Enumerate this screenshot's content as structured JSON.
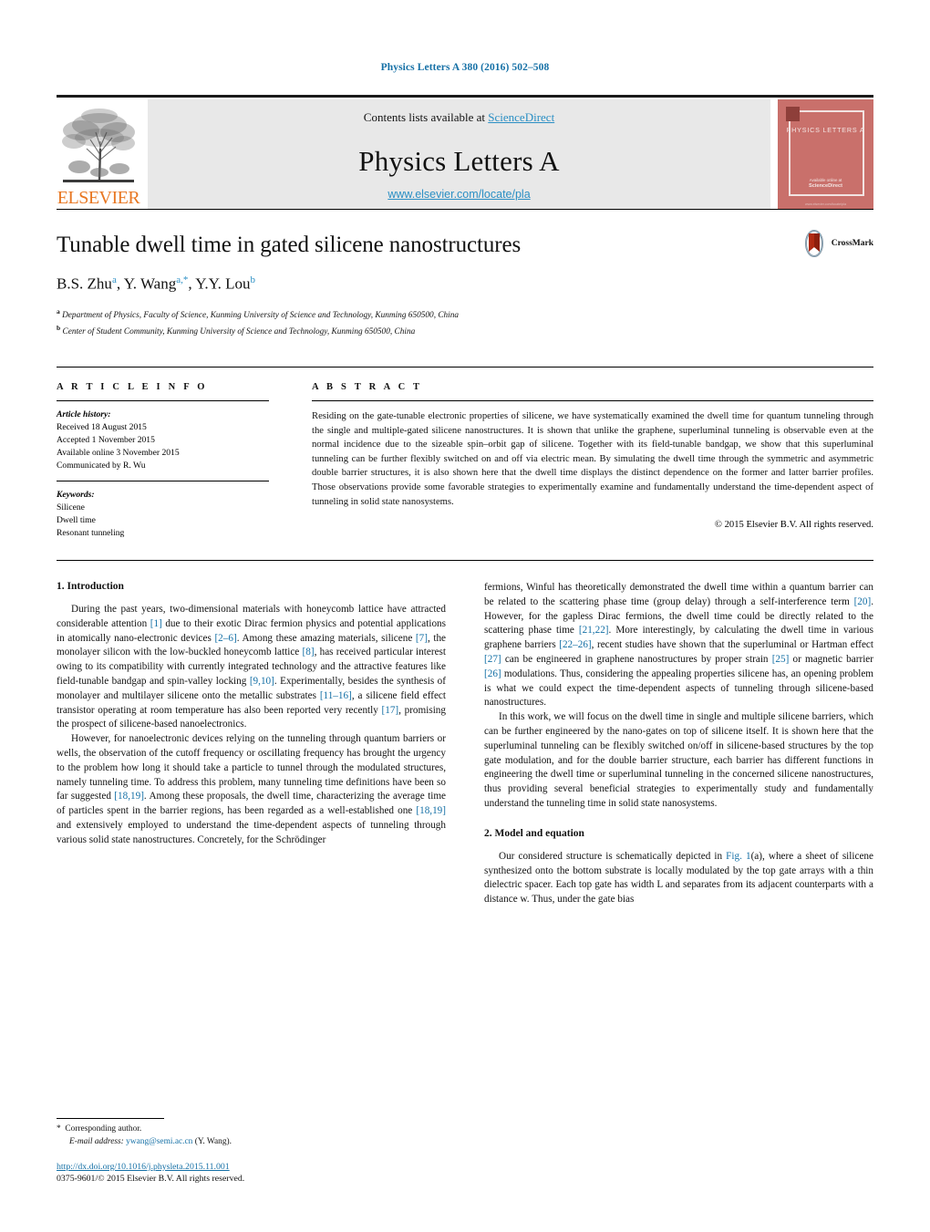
{
  "running_head": "Physics Letters A 380 (2016) 502–508",
  "banner": {
    "publisher_name": "ELSEVIER",
    "contents_prefix": "Contents lists available at ",
    "contents_link": "ScienceDirect",
    "journal_title": "Physics Letters A",
    "journal_url": "www.elsevier.com/locate/pla",
    "cover_title": "PHYSICS LETTERS A",
    "cover_foot_small": "Available online at",
    "cover_foot_brand": "ScienceDirect",
    "cover_bottom": "www.elsevier.com/locate/pla"
  },
  "title_block": {
    "title": "Tunable dwell time in gated silicene nanostructures",
    "authors": [
      {
        "name": "B.S. Zhu",
        "marks": "a"
      },
      {
        "name": "Y. Wang",
        "marks": "a,*"
      },
      {
        "name": "Y.Y. Lou",
        "marks": "b"
      }
    ],
    "affiliations": [
      {
        "mark": "a",
        "text": "Department of Physics, Faculty of Science, Kunming University of Science and Technology, Kunming 650500, China"
      },
      {
        "mark": "b",
        "text": "Center of Student Community, Kunming University of Science and Technology, Kunming 650500, China"
      }
    ],
    "crossmark_label": "CrossMark"
  },
  "article_info": {
    "heading": "A R T I C L E  I N F O",
    "history_heading": "Article history:",
    "history": [
      "Received 18 August 2015",
      "Accepted 1 November 2015",
      "Available online 3 November 2015",
      "Communicated by R. Wu"
    ],
    "keywords_heading": "Keywords:",
    "keywords": [
      "Silicene",
      "Dwell time",
      "Resonant tunneling"
    ]
  },
  "abstract": {
    "heading": "A B S T R A C T",
    "text": "Residing on the gate-tunable electronic properties of silicene, we have systematically examined the dwell time for quantum tunneling through the single and multiple-gated silicene nanostructures. It is shown that unlike the graphene, superluminal tunneling is observable even at the normal incidence due to the sizeable spin–orbit gap of silicene. Together with its field-tunable bandgap, we show that this superluminal tunneling can be further flexibly switched on and off via electric mean. By simulating the dwell time through the symmetric and asymmetric double barrier structures, it is also shown here that the dwell time displays the distinct dependence on the former and latter barrier profiles. Those observations provide some favorable strategies to experimentally examine and fundamentally understand the time-dependent aspect of tunneling in solid state nanosystems.",
    "copyright": "© 2015 Elsevier B.V. All rights reserved."
  },
  "body": {
    "left": {
      "section1_heading": "1. Introduction",
      "p1_a": "During the past years, two-dimensional materials with honeycomb lattice have attracted considerable attention ",
      "p1_r1": "[1]",
      "p1_b": " due to their exotic Dirac fermion physics and potential applications in atomically nano-electronic devices ",
      "p1_r2": "[2–6]",
      "p1_c": ". Among these amazing materials, silicene ",
      "p1_r3": "[7]",
      "p1_d": ", the monolayer silicon with the low-buckled honeycomb lattice ",
      "p1_r4": "[8]",
      "p1_e": ", has received particular interest owing to its compatibility with currently integrated technology and the attractive features like field-tunable bandgap and spin-valley locking ",
      "p1_r5": "[9,10]",
      "p1_f": ". Experimentally, besides the synthesis of monolayer and multilayer silicene onto the metallic substrates ",
      "p1_r6": "[11–16]",
      "p1_g": ", a silicene field effect transistor operating at room temperature has also been reported very recently ",
      "p1_r7": "[17]",
      "p1_h": ", promising the prospect of silicene-based nanoelectronics.",
      "p2_a": "However, for nanoelectronic devices relying on the tunneling through quantum barriers or wells, the observation of the cutoff frequency or oscillating frequency has brought the urgency to the problem how long it should take a particle to tunnel through the modulated structures, namely tunneling time. To address this problem, many tunneling time definitions have been so far suggested ",
      "p2_r1": "[18,19]",
      "p2_b": ". Among these proposals, the dwell time, characterizing the average time of particles spent in the barrier regions, has been regarded as a well-established one ",
      "p2_r2": "[18,19]",
      "p2_c": " and extensively employed to understand the time-dependent aspects of tunneling through various solid state nanostructures. Concretely, for the Schrödinger"
    },
    "right": {
      "p3_a": "fermions, Winful has theoretically demonstrated the dwell time within a quantum barrier can be related to the scattering phase time (group delay) through a self-interference term ",
      "p3_r1": "[20]",
      "p3_b": ". However, for the gapless Dirac fermions, the dwell time could be directly related to the scattering phase time ",
      "p3_r2": "[21,22]",
      "p3_c": ". More interestingly, by calculating the dwell time in various graphene barriers ",
      "p3_r3": "[22–26]",
      "p3_d": ", recent studies have shown that the superluminal or Hartman effect ",
      "p3_r4": "[27]",
      "p3_e": " can be engineered in graphene nanostructures by proper strain ",
      "p3_r5": "[25]",
      "p3_f": " or magnetic barrier ",
      "p3_r6": "[26]",
      "p3_g": " modulations. Thus, considering the appealing properties silicene has, an opening problem is what we could expect the time-dependent aspects of tunneling through silicene-based nanostructures.",
      "p4": "In this work, we will focus on the dwell time in single and multiple silicene barriers, which can be further engineered by the nano-gates on top of silicene itself. It is shown here that the superluminal tunneling can be flexibly switched on/off in silicene-based structures by the top gate modulation, and for the double barrier structure, each barrier has different functions in engineering the dwell time or superluminal tunneling in the concerned silicene nanostructures, thus providing several beneficial strategies to experimentally study and fundamentally understand the tunneling time in solid state nanosystems.",
      "section2_heading": "2. Model and equation",
      "p5_a": "Our considered structure is schematically depicted in ",
      "p5_r1": "Fig. 1",
      "p5_b": "(a), where a sheet of silicene synthesized onto the bottom substrate is locally modulated by the top gate arrays with a thin dielectric spacer. Each top gate has width L and separates from its adjacent counterparts with a distance w. Thus, under the gate bias"
    }
  },
  "footnote": {
    "star": "*",
    "corresponding": "Corresponding author.",
    "email_label": "E-mail address:",
    "email": "ywang@semi.ac.cn",
    "email_suffix": " (Y. Wang).",
    "doi": "http://dx.doi.org/10.1016/j.physleta.2015.11.001",
    "issn": "0375-9601/© 2015 Elsevier B.V. All rights reserved."
  },
  "colors": {
    "link": "#1570a6",
    "accent_blue": "#2b8fc4",
    "elsevier_orange": "#E87722",
    "cover_red": "#c9706b"
  }
}
